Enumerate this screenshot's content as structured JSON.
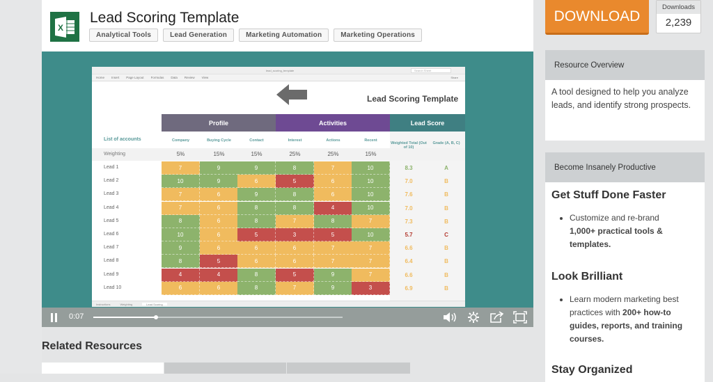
{
  "header": {
    "app_icon": "excel-icon",
    "title": "Lead Scoring Template",
    "tags": [
      "Analytical Tools",
      "Lead Generation",
      "Marketing Automation",
      "Marketing Operations"
    ]
  },
  "video": {
    "sheet": {
      "toolbar_menu": [
        "Home",
        "Insert",
        "Page Layout",
        "Formulas",
        "Data",
        "Review",
        "View"
      ],
      "filename": "lead_scoring_template",
      "search_placeholder": "Search Sheet",
      "share_label": "Share",
      "title": "Lead Scoring Template",
      "groups": [
        {
          "label": "Profile",
          "color": "#6f6a7e"
        },
        {
          "label": "Activities",
          "color": "#6e4a93"
        },
        {
          "label": "Lead Score",
          "color": "#3f7f82"
        }
      ],
      "accounts_label": "List of accounts",
      "columns": [
        "Company",
        "Buying Cycle",
        "Contact",
        "Interest",
        "Actions",
        "Recent"
      ],
      "score_columns": [
        "Weighted Total (Out of 10)",
        "Grade (A, B, C)"
      ],
      "weighting_label": "Weighting",
      "weights": [
        "5%",
        "15%",
        "15%",
        "25%",
        "25%",
        "15%"
      ],
      "rows": [
        {
          "label": "Lead 1",
          "values": [
            7,
            9,
            9,
            8,
            7,
            10
          ],
          "total": "8.3",
          "grade": "A"
        },
        {
          "label": "Lead 2",
          "values": [
            10,
            9,
            6,
            5,
            6,
            10
          ],
          "total": "7.0",
          "grade": "B"
        },
        {
          "label": "Lead 3",
          "values": [
            7,
            6,
            9,
            8,
            6,
            10
          ],
          "total": "7.6",
          "grade": "B"
        },
        {
          "label": "Lead 4",
          "values": [
            7,
            6,
            8,
            8,
            4,
            10
          ],
          "total": "7.0",
          "grade": "B"
        },
        {
          "label": "Lead 5",
          "values": [
            8,
            6,
            8,
            7,
            8,
            7
          ],
          "total": "7.3",
          "grade": "B"
        },
        {
          "label": "Lead 6",
          "values": [
            10,
            6,
            5,
            3,
            5,
            10
          ],
          "total": "5.7",
          "grade": "C"
        },
        {
          "label": "Lead 7",
          "values": [
            9,
            6,
            6,
            6,
            7,
            7
          ],
          "total": "6.6",
          "grade": "B"
        },
        {
          "label": "Lead 8",
          "values": [
            8,
            5,
            6,
            6,
            7,
            7
          ],
          "total": "6.4",
          "grade": "B"
        },
        {
          "label": "Lead 9",
          "values": [
            4,
            4,
            8,
            5,
            9,
            7
          ],
          "total": "6.6",
          "grade": "B"
        },
        {
          "label": "Lead 10",
          "values": [
            6,
            6,
            8,
            7,
            9,
            3
          ],
          "total": "6.9",
          "grade": "B"
        }
      ],
      "sheet_tabs": [
        "Instructions",
        "Weighting",
        "Lead Scoring"
      ],
      "active_tab": "Lead Scoring",
      "colors": {
        "high": "#8db36c",
        "mid": "#f0bb5e",
        "low": "#c44f4c",
        "grade_a": "#8db36c",
        "grade_b": "#f0bb5e",
        "grade_c": "#b3392f"
      }
    },
    "controls": {
      "time": "0:07",
      "progress_fraction": 0.25
    }
  },
  "related": {
    "title": "Related Resources"
  },
  "sidebar": {
    "download_label": "DOWNLOAD",
    "downloads_label": "Downloads",
    "downloads_count": "2,239",
    "overview": {
      "title": "Resource Overview",
      "text": "A tool designed to help you analyze leads, and identify strong prospects."
    },
    "productive": {
      "title": "Become Insanely Productive",
      "sections": [
        {
          "heading": "Get Stuff Done Faster",
          "plain": "Customize and re-brand ",
          "bold": "1,000+ practical tools & templates."
        },
        {
          "heading": "Look Brilliant",
          "plain": "Learn modern marketing best practices with ",
          "bold": "200+ how-to guides, reports, and training courses."
        },
        {
          "heading": "Stay Organized"
        }
      ]
    }
  }
}
